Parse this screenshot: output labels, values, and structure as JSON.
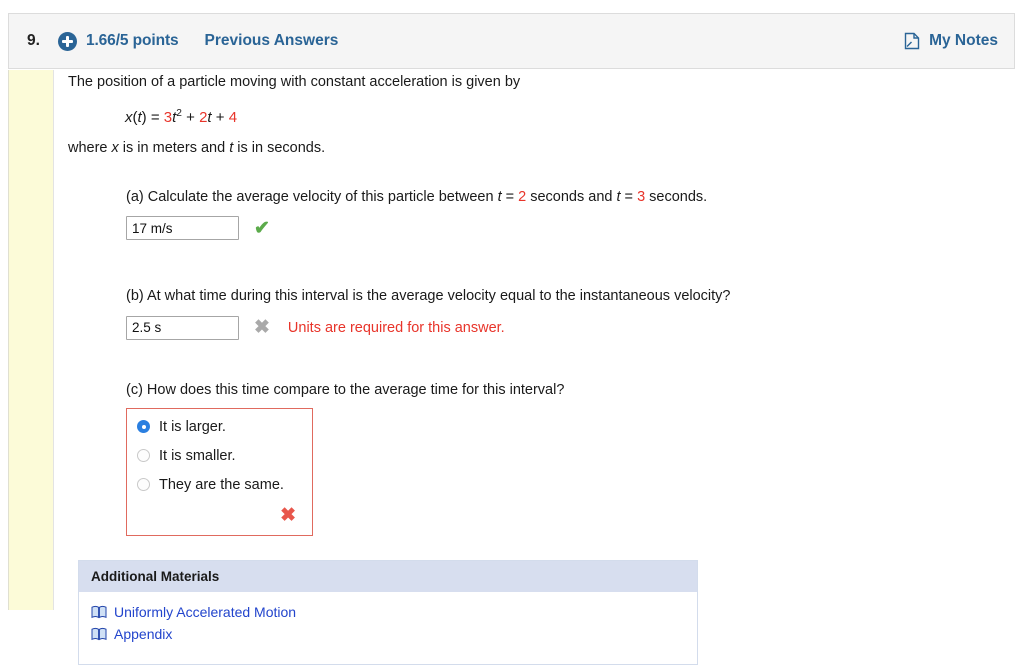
{
  "header": {
    "question_number": "9.",
    "plus_icon": "plus-circle-icon",
    "points": "1.66/5 points",
    "previous_answers": "Previous Answers",
    "notes_icon": "note-page-icon",
    "notes_label": "My Notes",
    "accent_color": "#2a6496",
    "background": "#f5f5f5"
  },
  "problem": {
    "intro": "The position of a particle moving with constant acceleration is given by",
    "equation": {
      "lhs_x": "x",
      "lhs_paren_open": "(",
      "lhs_t": "t",
      "lhs_paren_close": ")",
      "equals": " = ",
      "coef1": "3",
      "var1": "t",
      "exp1": "2",
      "plus1": " + ",
      "coef2": "2",
      "var2": "t",
      "plus2": " + ",
      "const": "4",
      "number_color": "#e8342a"
    },
    "where_prefix": "where ",
    "where_x": "x",
    "where_mid": " is in meters and ",
    "where_t": "t",
    "where_suffix": " is in seconds."
  },
  "parts": {
    "a": {
      "label": "(a) Calculate the average velocity of this particle between ",
      "t_var1": "t",
      "eq1": " = ",
      "t_val1": "2",
      "mid": " seconds and ",
      "t_var2": "t",
      "eq2": " = ",
      "t_val2": "3",
      "tail": " seconds.",
      "answer_value": "17 m/s",
      "answer_placeholder": "",
      "mark": "✔",
      "mark_kind": "correct",
      "mark_color": "#5cab4b"
    },
    "b": {
      "label": "(b) At what time during this interval is the average velocity equal to the instantaneous velocity?",
      "answer_value": "2.5 s",
      "answer_placeholder": "",
      "mark": "✖",
      "mark_kind": "incorrect-gray",
      "mark_color": "#a9a9a9",
      "error_message": "Units are required for this answer.",
      "error_color": "#e8342a"
    },
    "c": {
      "label": "(c) How does this time compare to the average time for this interval?",
      "options": [
        {
          "label": "It is larger.",
          "selected": true
        },
        {
          "label": "It is smaller.",
          "selected": false
        },
        {
          "label": "They are the same.",
          "selected": false
        }
      ],
      "mark": "✖",
      "mark_color": "#e8564b",
      "box_border_color": "#e06a5e"
    }
  },
  "materials": {
    "title": "Additional Materials",
    "header_background": "#d7deef",
    "link_color": "#2244cc",
    "items": [
      {
        "icon": "book-icon",
        "label": "Uniformly Accelerated Motion"
      },
      {
        "icon": "book-icon",
        "label": "Appendix"
      }
    ]
  }
}
